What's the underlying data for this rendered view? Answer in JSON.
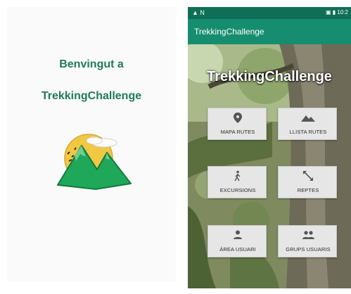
{
  "splash": {
    "welcome": "Benvingut a",
    "app_name": "TrekkingChallenge",
    "logo_icon": "mountain-sun-logo"
  },
  "phone": {
    "status_left": "▲ N",
    "status_right": "▣ ▮ 10:2",
    "appbar_title": "TrekkingChallenge",
    "hero_title": "TrekkingChallenge",
    "tiles": [
      {
        "label": "MAPA RUTES",
        "icon": "location-pin-icon"
      },
      {
        "label": "LLISTA RUTES",
        "icon": "terrain-icon"
      },
      {
        "label": "EXCURSIONS",
        "icon": "hiker-icon"
      },
      {
        "label": "REPTES",
        "icon": "expand-arrows-icon"
      },
      {
        "label": "ÀREA USUARI",
        "icon": "person-icon"
      },
      {
        "label": "GRUPS USUARIS",
        "icon": "people-icon"
      }
    ]
  },
  "colors": {
    "primary": "#168d6f",
    "primary_dark": "#0f6e56",
    "splash_text": "#1f7a5e",
    "tile_bg": "#e6e6e6"
  }
}
